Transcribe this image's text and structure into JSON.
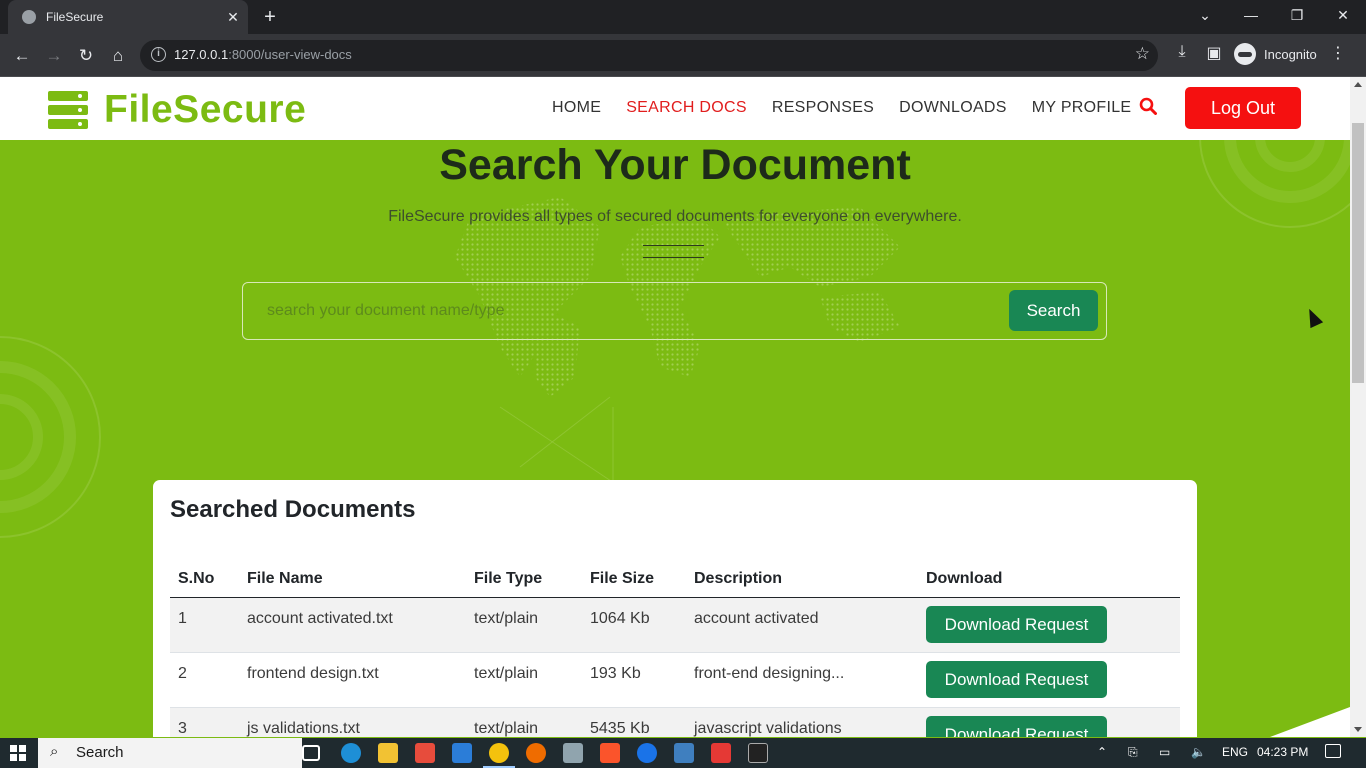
{
  "browser": {
    "tab_title": "FileSecure",
    "url_host": "127.0.0.1",
    "url_rest": ":8000/user-view-docs",
    "incognito_label": "Incognito"
  },
  "site": {
    "brand": "FileSecure",
    "nav": [
      "HOME",
      "SEARCH DOCS",
      "RESPONSES",
      "DOWNLOADS",
      "MY PROFILE"
    ],
    "active_nav": "SEARCH DOCS",
    "logout_label": "Log Out",
    "accent": "#7cbb12"
  },
  "hero": {
    "title": "Search Your Document",
    "subtitle": "FileSecure provides all types of secured documents for everyone on everywhere.",
    "search_placeholder": "search your document name/type",
    "search_button": "Search"
  },
  "results": {
    "title": "Searched Documents",
    "columns": [
      "S.No",
      "File Name",
      "File Type",
      "File Size",
      "Description",
      "Download"
    ],
    "rows": [
      {
        "sno": "1",
        "name": "account activated.txt",
        "type": "text/plain",
        "size": "1064 Kb",
        "desc": "account activated",
        "action": "Download Request"
      },
      {
        "sno": "2",
        "name": "frontend design.txt",
        "type": "text/plain",
        "size": "193 Kb",
        "desc": "front-end designing...",
        "action": "Download Request"
      },
      {
        "sno": "3",
        "name": "js validations.txt",
        "type": "text/plain",
        "size": "5435 Kb",
        "desc": "javascript validations",
        "action": "Download Request"
      }
    ]
  },
  "taskbar": {
    "search_label": "Search",
    "lang": "ENG",
    "time": "04:23 PM"
  }
}
